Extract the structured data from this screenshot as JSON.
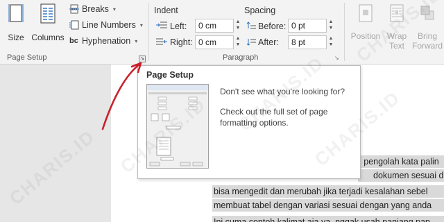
{
  "ribbon": {
    "page_setup": {
      "size_label": "Size",
      "columns_label": "Columns",
      "breaks_label": "Breaks",
      "line_numbers_label": "Line Numbers",
      "hyphenation_label": "Hyphenation",
      "group_label": "Page Setup"
    },
    "paragraph": {
      "indent_heading": "Indent",
      "spacing_heading": "Spacing",
      "left_label": "Left:",
      "left_value": "0 cm",
      "right_label": "Right:",
      "right_value": "0 cm",
      "before_label": "Before:",
      "before_value": "0 pt",
      "after_label": "After:",
      "after_value": "8 pt",
      "group_label": "Paragraph"
    },
    "arrange": {
      "position_label": "Position",
      "wrap_text_label": "Wrap Text",
      "bring_forward_label": "Bring Forward"
    }
  },
  "tooltip": {
    "title": "Page Setup",
    "line1": "Don't see what you're looking for?",
    "line2": "Check out the full set of page formatting options."
  },
  "document": {
    "lines": [
      "i pengolah kata palin",
      "dokumen sesuai de",
      "bisa mengedit dan merubah jika terjadi kesalahan sebel",
      "membuat tabel dengan variasi sesuai dengan yang anda",
      "Ini cuma contoh kalimat aja ya, nggak usah panjang pan"
    ]
  },
  "watermark": "CHARIS.ID",
  "colors": {
    "annotation_arrow": "#c8202a",
    "ribbon_bg": "#f3f3f3",
    "highlight": "#d9d9d9"
  }
}
